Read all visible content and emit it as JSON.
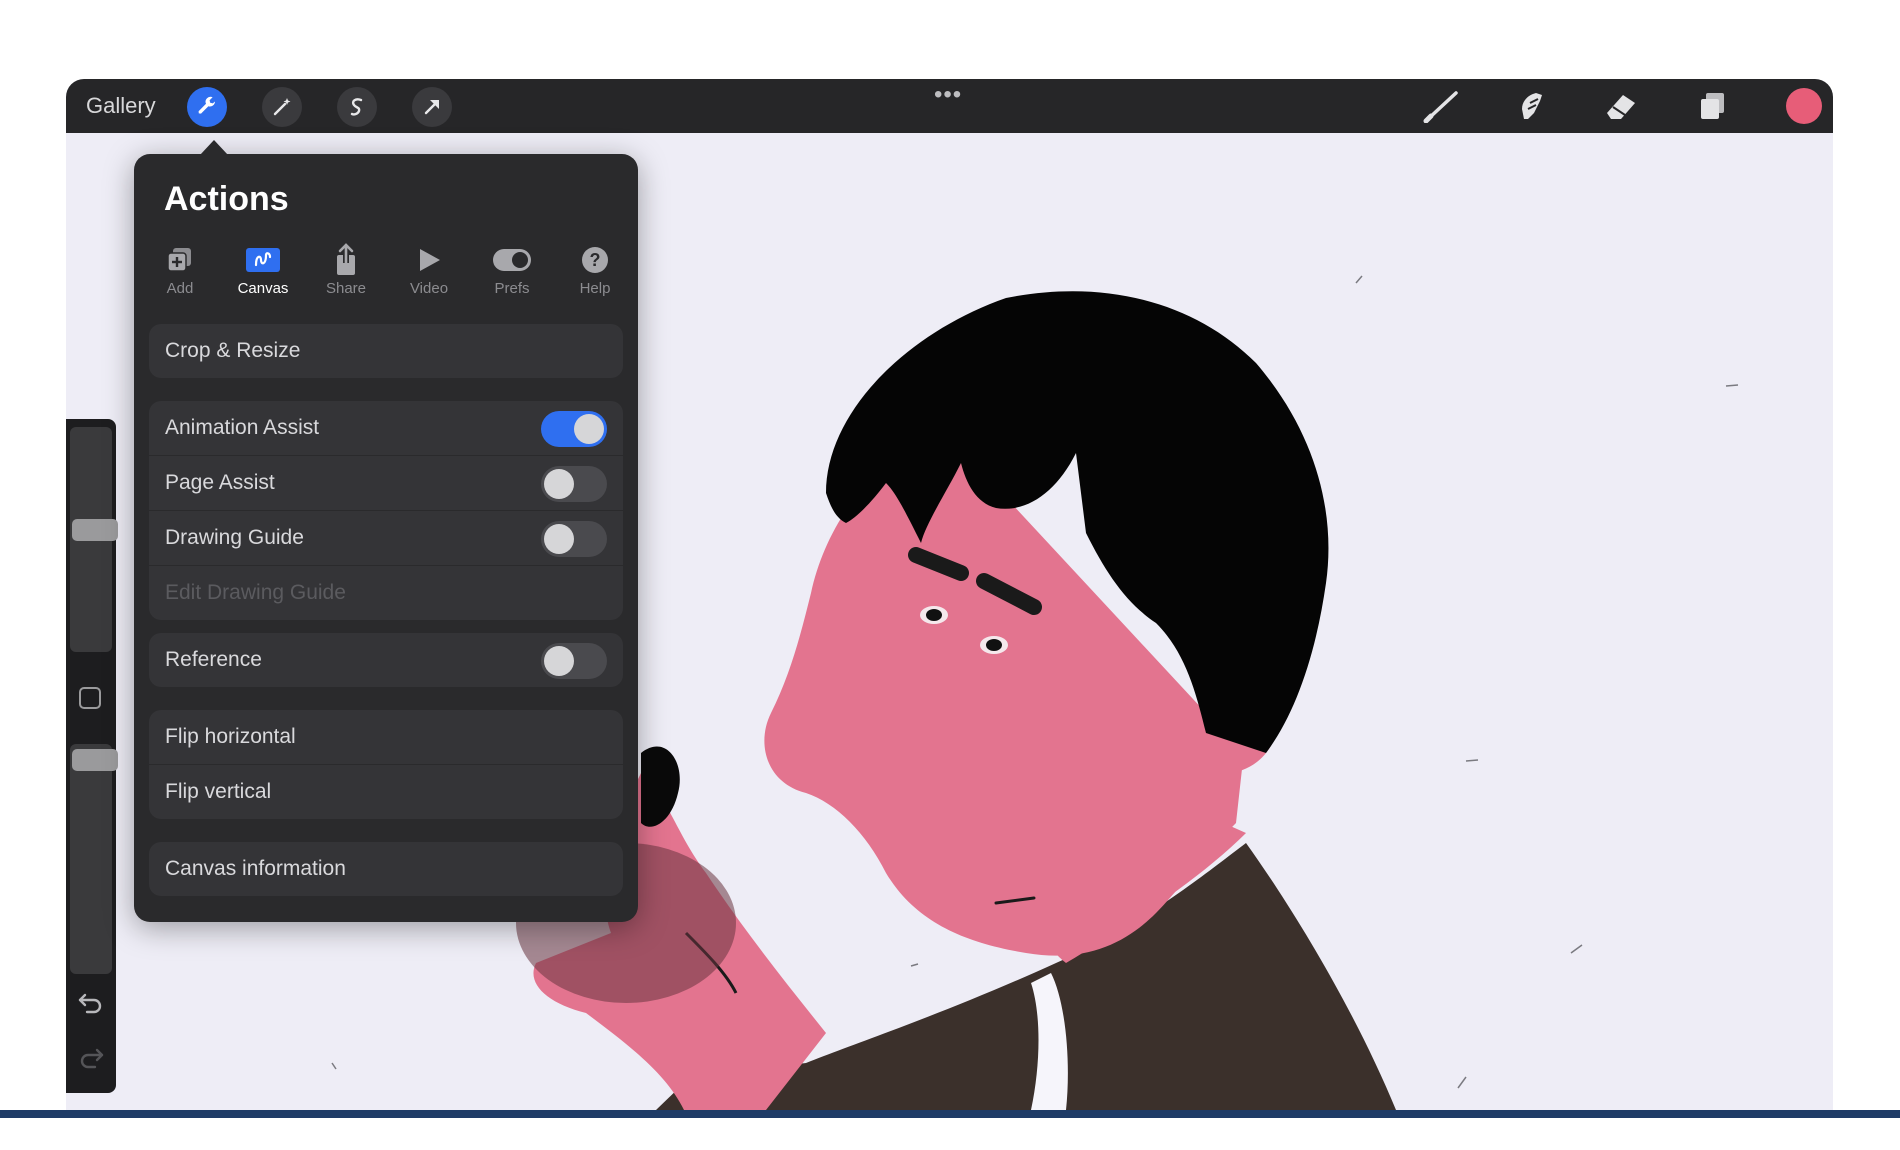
{
  "topbar": {
    "gallery_label": "Gallery",
    "more_label": "•••",
    "active_color": "#e75d78",
    "tools_left": [
      "wrench-icon",
      "magic-wand-icon",
      "selection-icon",
      "transform-arrow-icon"
    ],
    "tools_right": [
      "brush-icon",
      "smudge-icon",
      "eraser-icon",
      "layers-icon"
    ]
  },
  "actions": {
    "title": "Actions",
    "tabs": [
      {
        "label": "Add",
        "icon": "add-icon"
      },
      {
        "label": "Canvas",
        "icon": "canvas-icon",
        "active": true
      },
      {
        "label": "Share",
        "icon": "share-icon"
      },
      {
        "label": "Video",
        "icon": "video-icon"
      },
      {
        "label": "Prefs",
        "icon": "prefs-toggle-icon"
      },
      {
        "label": "Help",
        "icon": "help-icon"
      }
    ],
    "items": {
      "crop_resize": "Crop & Resize",
      "animation_assist": {
        "label": "Animation Assist",
        "on": true
      },
      "page_assist": {
        "label": "Page Assist",
        "on": false
      },
      "drawing_guide": {
        "label": "Drawing Guide",
        "on": false
      },
      "edit_drawing_guide": "Edit Drawing Guide",
      "reference": {
        "label": "Reference",
        "on": false
      },
      "flip_horizontal": "Flip horizontal",
      "flip_vertical": "Flip vertical",
      "canvas_information": "Canvas information"
    }
  },
  "sidebar": {
    "icons": [
      "brush-size-slider",
      "modify-square-icon",
      "opacity-slider",
      "undo-icon",
      "redo-icon"
    ]
  },
  "colors": {
    "accent": "#2f6ff0",
    "skin": "#e3748f",
    "hair": "#050505",
    "shirt": "#3b302b",
    "canvas_bg": "#eeedf6"
  }
}
